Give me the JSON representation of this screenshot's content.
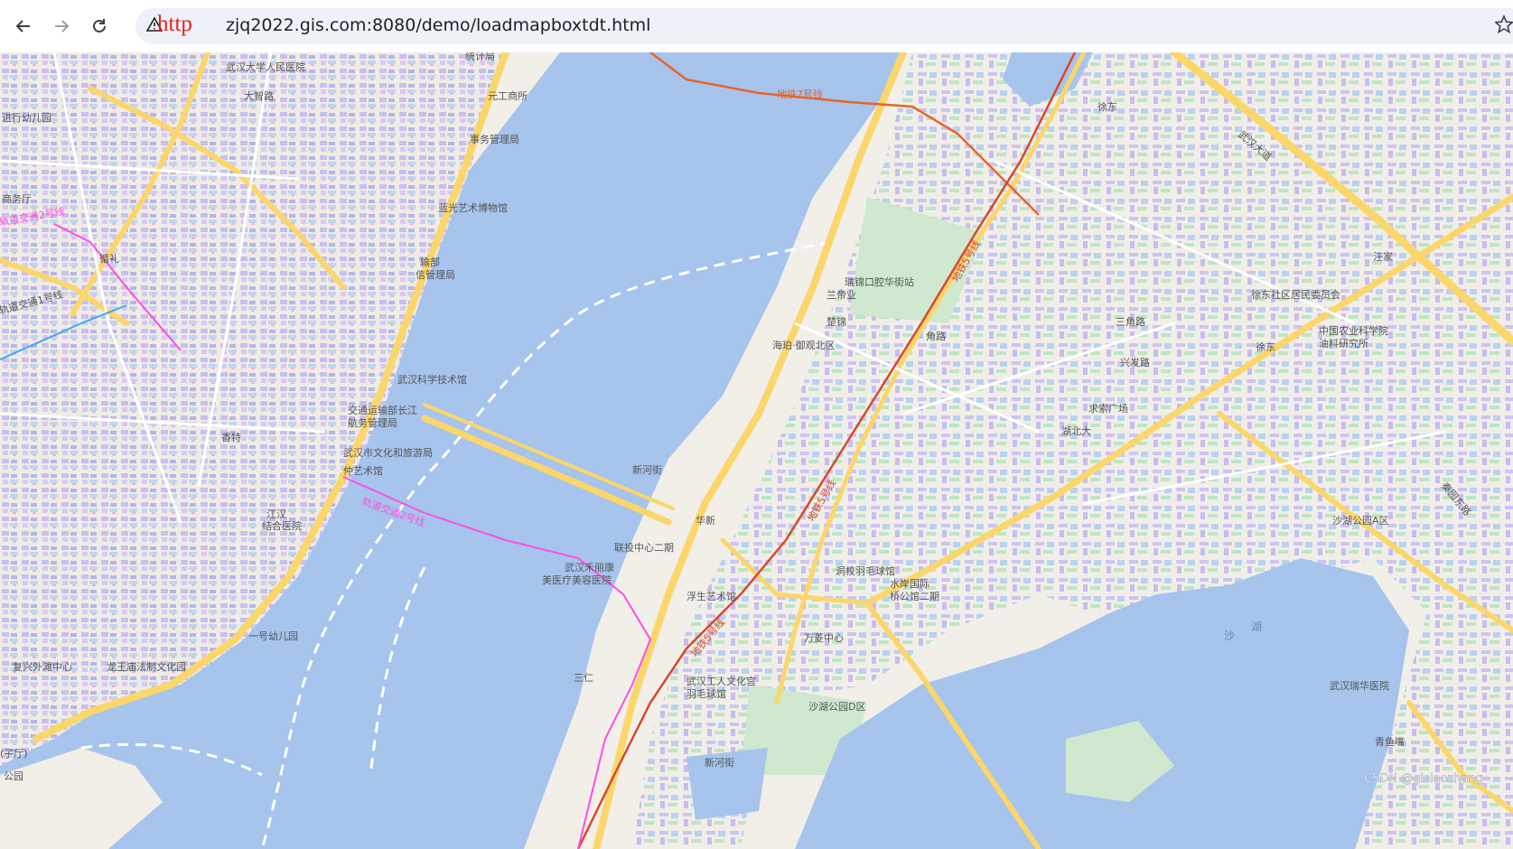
{
  "browser": {
    "protocol_text": "http",
    "url": "zjq2022.gis.com:8080/demo/loadmapboxtdt.html",
    "icons": {
      "back": "arrow-left-icon",
      "forward": "arrow-right-icon",
      "reload": "reload-icon",
      "not_secure": "warning-triangle-icon",
      "bookmark": "star-icon"
    }
  },
  "map": {
    "water_color": "#a6c4ec",
    "land_color": "#f2efe9",
    "watermark": "CSDN @gislaozhang",
    "metro_lines": [
      {
        "label": "地铁7号线",
        "color": "#e8642c"
      },
      {
        "label": "地铁5号线",
        "color": "#d9472b"
      },
      {
        "label": "轨道交通2号线",
        "color": "#ff4de3"
      }
    ],
    "labels": [
      {
        "text": "武汉大学人民医院"
      },
      {
        "text": "大智路"
      },
      {
        "text": "进行幼儿园"
      },
      {
        "text": "商务厅"
      },
      {
        "text": "轨道交通2号线"
      },
      {
        "text": "循礼"
      },
      {
        "text": "轨道交通1号线"
      },
      {
        "text": "统计局"
      },
      {
        "text": "元工商所"
      },
      {
        "text": "事务管理局"
      },
      {
        "text": "蓝光艺术博物馆"
      },
      {
        "text": "输部"
      },
      {
        "text": "信管理局"
      },
      {
        "text": "武汉科学技术馆"
      },
      {
        "text": "交通运输部长江"
      },
      {
        "text": "航务管理局"
      },
      {
        "text": "武汉市文化和旅游局"
      },
      {
        "text": "仲艺术馆"
      },
      {
        "text": "香特"
      },
      {
        "text": "江汉"
      },
      {
        "text": "结合医院"
      },
      {
        "text": "一号幼儿园"
      },
      {
        "text": "复兴外滩中心"
      },
      {
        "text": "龙王庙法制文化园"
      },
      {
        "text": "公园"
      },
      {
        "text": "(子厅)"
      },
      {
        "text": "徐东"
      },
      {
        "text": "武汉大道"
      },
      {
        "text": "瑞锦口腔华街站"
      },
      {
        "text": "兰帝业"
      },
      {
        "text": "楚锦"
      },
      {
        "text": "角路"
      },
      {
        "text": "海珀·御观北区"
      },
      {
        "text": "新河街"
      },
      {
        "text": "华新"
      },
      {
        "text": "联投中心二期"
      },
      {
        "text": "武汉禾丽康"
      },
      {
        "text": "美医疗美容医院"
      },
      {
        "text": "浮生艺术馆"
      },
      {
        "text": "三仁"
      },
      {
        "text": "武汉工人文化宫"
      },
      {
        "text": "羽毛球馆"
      },
      {
        "text": "新河街"
      },
      {
        "text": "洞校羽毛球馆"
      },
      {
        "text": "水岸国际"
      },
      {
        "text": "桥公馆二期"
      },
      {
        "text": "万菱中心"
      },
      {
        "text": "沙湖公园D区"
      },
      {
        "text": "求索广场"
      },
      {
        "text": "湖北大"
      },
      {
        "text": "沙湖公园A区"
      },
      {
        "text": "三角路"
      },
      {
        "text": "兴发路"
      },
      {
        "text": "中国农业科学院"
      },
      {
        "text": "油料研究所"
      },
      {
        "text": "徐东社区居民委员会"
      },
      {
        "text": "武汉瑞华医院"
      },
      {
        "text": "青鱼嘴"
      },
      {
        "text": "沙"
      },
      {
        "text": "湖"
      },
      {
        "text": "汪家"
      },
      {
        "text": "秦园东路"
      },
      {
        "text": "徐东"
      }
    ]
  }
}
